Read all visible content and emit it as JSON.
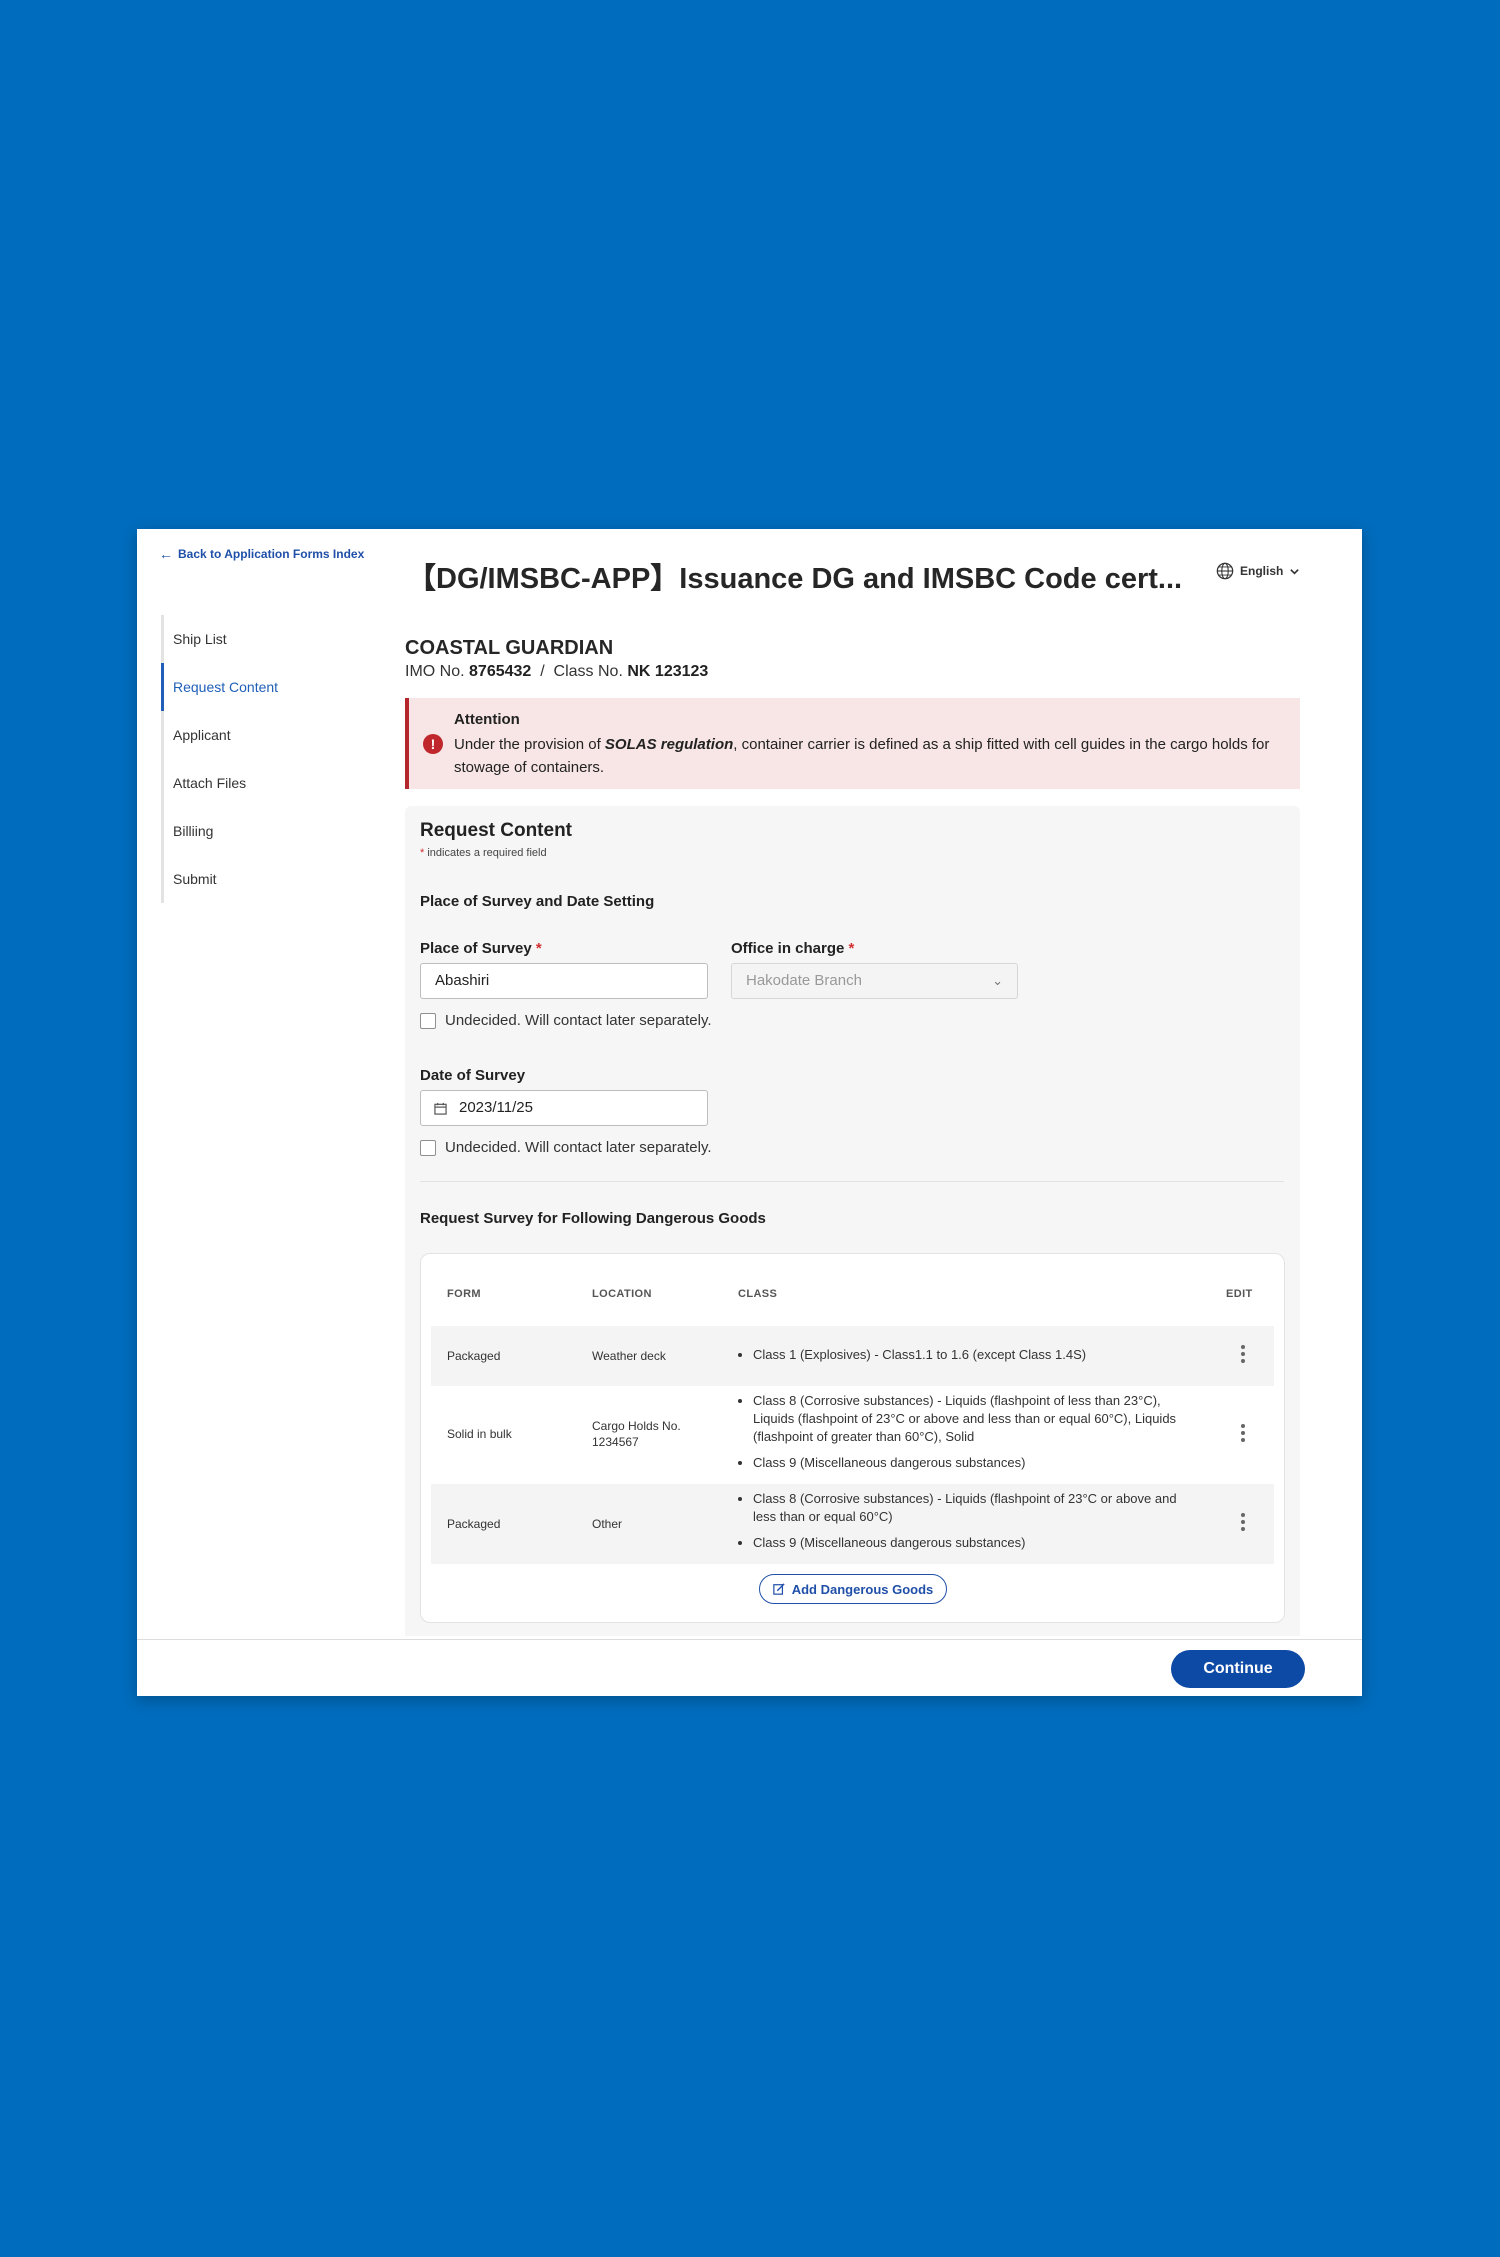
{
  "back_link": "Back to Application Forms Index",
  "title": "【DG/IMSBC-APP】Issuance DG and IMSBC Code cert...",
  "language": "English",
  "nav": {
    "items": [
      {
        "label": "Ship List"
      },
      {
        "label": "Request Content"
      },
      {
        "label": "Applicant"
      },
      {
        "label": "Attach Files"
      },
      {
        "label": "Billiing"
      },
      {
        "label": "Submit"
      }
    ],
    "active": "Request Content"
  },
  "ship": {
    "name": "COASTAL GUARDIAN",
    "imo_label": "IMO No.",
    "imo": "8765432",
    "class_label": "Class No.",
    "class_no": "NK 123123"
  },
  "alert": {
    "title": "Attention",
    "body_pre": "Under the provision of ",
    "body_em": "SOLAS regulation",
    "body_post": ", container carrier is defined as a ship fitted with cell guides in the cargo holds for stowage of containers."
  },
  "form": {
    "title": "Request Content",
    "required_star": "*",
    "required_note": "indicates a required field",
    "section1": "Place of Survey and Date Setting",
    "place_label": "Place of Survey",
    "place_value": "Abashiri",
    "office_label": "Office in charge",
    "office_value": "Hakodate Branch",
    "undecided": "Undecided. Will contact later separately.",
    "date_label": "Date of Survey",
    "date_value": "2023/11/25",
    "section2": "Request Survey for Following Dangerous Goods"
  },
  "table": {
    "headers": {
      "form": "FORM",
      "location": "LOCATION",
      "class": "CLASS",
      "edit": "EDIT"
    },
    "rows": [
      {
        "form": "Packaged",
        "location": "Weather deck",
        "classes": [
          "Class 1  (Explosives) - Class1.1 to 1.6 (except Class 1.4S)"
        ]
      },
      {
        "form": "Solid in bulk",
        "location": "Cargo Holds No. 1234567",
        "classes": [
          "Class 8  (Corrosive substances) - Liquids (flashpoint of less than 23°C), Liquids (flashpoint of 23°C or above and less than or equal 60°C), Liquids (flashpoint of greater than 60°C), Solid",
          "Class 9  (Miscellaneous dangerous substances)"
        ]
      },
      {
        "form": "Packaged",
        "location": "Other",
        "classes": [
          "Class 8  (Corrosive substances) - Liquids (flashpoint of 23°C or above and less than or equal 60°C)",
          "Class 9  (Miscellaneous dangerous substances)"
        ]
      }
    ],
    "add_button": "Add Dangerous Goods"
  },
  "continue_button": "Continue",
  "colors": {
    "background": "#006cbd",
    "primary": "#0c4aa6",
    "link": "#1f4fa8",
    "alert_bg": "#f8e6e6",
    "alert_border": "#b3262c",
    "required": "#d32f2f"
  }
}
